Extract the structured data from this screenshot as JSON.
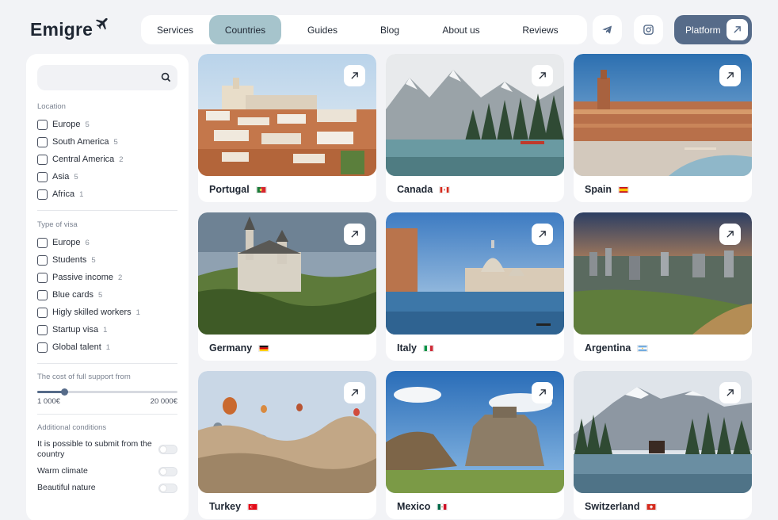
{
  "brand": {
    "name": "Emigre"
  },
  "nav": {
    "items": [
      {
        "label": "Services"
      },
      {
        "label": "Countries",
        "active": true
      },
      {
        "label": "Guides"
      },
      {
        "label": "Blog"
      },
      {
        "label": "About us"
      },
      {
        "label": "Reviews"
      }
    ],
    "icons": [
      "telegram-icon",
      "instagram-icon"
    ],
    "platform_label": "Platform"
  },
  "filters": {
    "search": {
      "placeholder": "",
      "icon": "search-icon"
    },
    "location": {
      "title": "Location",
      "options": [
        {
          "label": "Europe",
          "count": "5"
        },
        {
          "label": "South America",
          "count": "5"
        },
        {
          "label": "Central America",
          "count": "2"
        },
        {
          "label": "Asia",
          "count": "5"
        },
        {
          "label": "Africa",
          "count": "1"
        }
      ]
    },
    "visa": {
      "title": "Type of visa",
      "options": [
        {
          "label": "Europe",
          "count": "6"
        },
        {
          "label": "Students",
          "count": "5"
        },
        {
          "label": "Passive income",
          "count": "2"
        },
        {
          "label": "Blue cards",
          "count": "5"
        },
        {
          "label": "Higly skilled workers",
          "count": "1"
        },
        {
          "label": "Startup visa",
          "count": "1"
        },
        {
          "label": "Global talent",
          "count": "1"
        }
      ]
    },
    "cost": {
      "title": "The cost of full support from",
      "min_label": "1 000€",
      "max_label": "20 000€",
      "fraction": 0.19
    },
    "additional": {
      "title": "Additional conditions",
      "toggles": [
        {
          "label": "It is possible to submit from the country",
          "on": false
        },
        {
          "label": "Warm climate",
          "on": false
        },
        {
          "label": "Beautiful nature",
          "on": false
        }
      ]
    }
  },
  "countries": [
    {
      "name": "Portugal",
      "flag": "portugal-flag"
    },
    {
      "name": "Canada",
      "flag": "canada-flag"
    },
    {
      "name": "Spain",
      "flag": "spain-flag"
    },
    {
      "name": "Germany",
      "flag": "germany-flag"
    },
    {
      "name": "Italy",
      "flag": "italy-flag"
    },
    {
      "name": "Argentina",
      "flag": "argentina-flag"
    },
    {
      "name": "Turkey",
      "flag": "turkey-flag"
    },
    {
      "name": "Mexico",
      "flag": "mexico-flag"
    },
    {
      "name": "Switzerland",
      "flag": "switzerland-flag"
    }
  ],
  "colors": {
    "accent": "#566b89",
    "nav_active": "#a6c4cc",
    "background": "#f2f3f6"
  }
}
